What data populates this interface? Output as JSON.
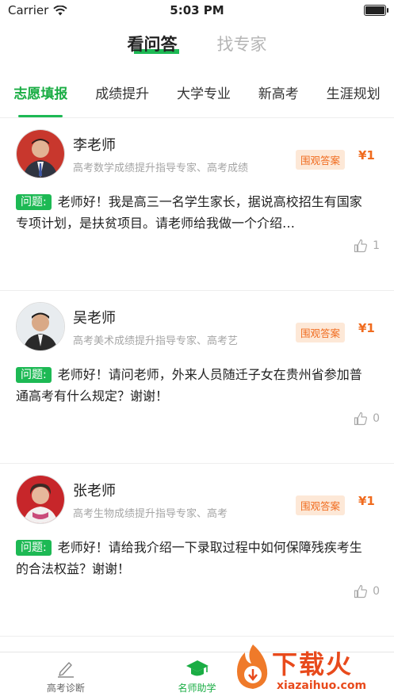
{
  "status": {
    "carrier": "Carrier",
    "time": "5:03 PM"
  },
  "top_nav": [
    {
      "label": "看问答",
      "active": true
    },
    {
      "label": "找专家",
      "active": false
    }
  ],
  "category_tabs": [
    {
      "label": "志愿填报",
      "active": true
    },
    {
      "label": "成绩提升",
      "active": false
    },
    {
      "label": "大学专业",
      "active": false
    },
    {
      "label": "新高考",
      "active": false
    },
    {
      "label": "生涯规划",
      "active": false
    }
  ],
  "questions": [
    {
      "teacher": "李老师",
      "title": "高考数学成绩提升指导专家、高考成绩",
      "badge": "围观答案",
      "price": "¥1",
      "tag": "问题:",
      "text": "老师好！我是高三一名学生家长，据说高校招生有国家专项计划，是扶贫项目。请老师给我做一个介绍…",
      "likes": "1",
      "avatar_bg": "#c8372d"
    },
    {
      "teacher": "吴老师",
      "title": "高考美术成绩提升指导专家、高考艺",
      "badge": "围观答案",
      "price": "¥1",
      "tag": "问题:",
      "text": "老师好！请问老师，外来人员随迁子女在贵州省参加普通高考有什么规定？谢谢！",
      "likes": "0",
      "avatar_bg": "#e8ecef"
    },
    {
      "teacher": "张老师",
      "title": "高考生物成绩提升指导专家、高考",
      "badge": "围观答案",
      "price": "¥1",
      "tag": "问题:",
      "text": "老师好！请给我介绍一下录取过程中如何保障残疾考生的合法权益？谢谢！",
      "likes": "0",
      "avatar_bg": "#c7262a"
    }
  ],
  "tabbar": [
    {
      "label": "高考诊断",
      "icon": "pencil-icon",
      "active": false
    },
    {
      "label": "名师助学",
      "icon": "graduation-cap-icon",
      "active": true
    }
  ],
  "watermark": {
    "text": "下载火",
    "url": "xiazaihuo.com"
  },
  "colors": {
    "accent": "#1db954",
    "price": "#f06b1e",
    "badge_bg": "#fde8d7"
  }
}
